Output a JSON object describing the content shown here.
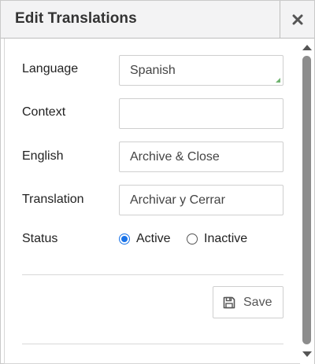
{
  "dialog": {
    "title": "Edit Translations",
    "close_icon": "close-icon"
  },
  "form": {
    "language": {
      "label": "Language",
      "value": "Spanish"
    },
    "context": {
      "label": "Context",
      "value": ""
    },
    "english": {
      "label": "English",
      "value": "Archive & Close"
    },
    "translation": {
      "label": "Translation",
      "value": "Archivar y Cerrar"
    },
    "status": {
      "label": "Status",
      "options": [
        {
          "label": "Active",
          "selected": true
        },
        {
          "label": "Inactive",
          "selected": false
        }
      ]
    }
  },
  "actions": {
    "save_label": "Save",
    "save_icon": "floppy-disk-icon"
  },
  "colors": {
    "titlebar_bg": "#f3f3f4",
    "radio_accent": "#1a73e8",
    "select_corner": "#6fb36f"
  }
}
